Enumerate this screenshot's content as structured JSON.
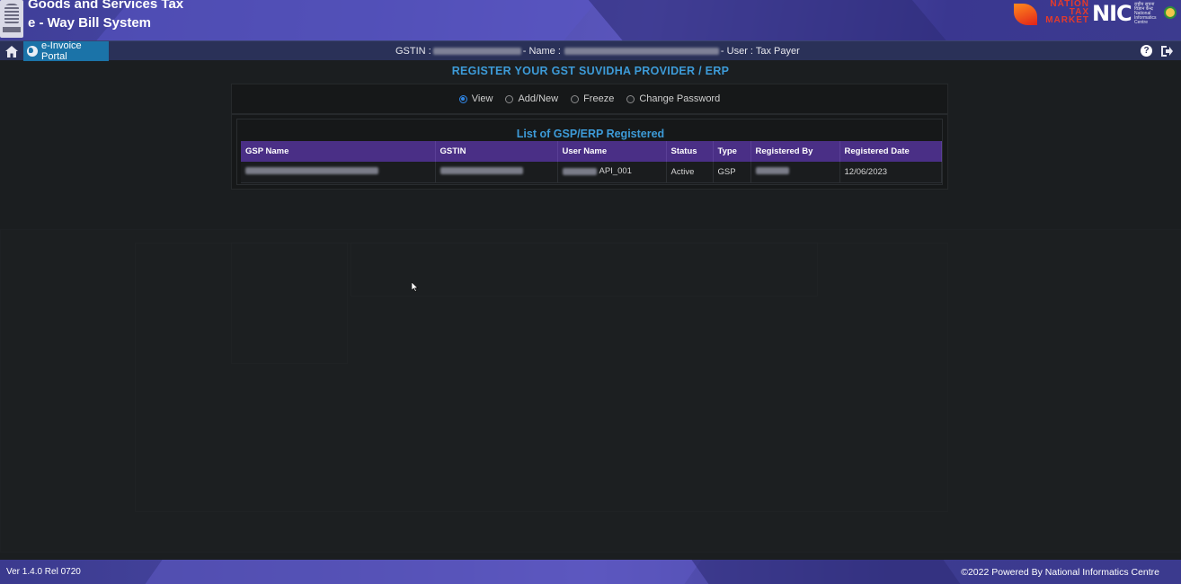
{
  "header": {
    "title_line1": "Goods and Services Tax",
    "title_line2": "e - Way Bill System",
    "ntm_logo_text": "NATION TAX MARKET",
    "nic_logo_text": "NIC",
    "nic_subtext": "राष्ट्रीय सूचना विज्ञान केन्द्र National Informatics Centre"
  },
  "navbar": {
    "home_icon": "home-icon",
    "portal_label": "e-Invoice Portal",
    "gstin_label": "GSTIN :",
    "name_label": "- Name :",
    "user_label": "- User : Tax Payer",
    "help_symbol": "?"
  },
  "main": {
    "page_title": "REGISTER YOUR GST SUVIDHA PROVIDER / ERP",
    "options": [
      {
        "label": "View",
        "checked": true
      },
      {
        "label": "Add/New",
        "checked": false
      },
      {
        "label": "Freeze",
        "checked": false
      },
      {
        "label": "Change Password",
        "checked": false
      }
    ],
    "list_title": "List of GSP/ERP Registered",
    "table": {
      "headers": [
        "GSP Name",
        "GSTIN",
        "User Name",
        "Status",
        "Type",
        "Registered By",
        "Registered Date"
      ],
      "rows": [
        {
          "gsp_name": "",
          "gstin": "",
          "user_name": "API_001",
          "status": "Active",
          "type": "GSP",
          "registered_by": "",
          "registered_date": "12/06/2023"
        }
      ]
    }
  },
  "footer": {
    "version": "Ver 1.4.0 Rel 0720",
    "powered_by": "©2022 Powered By National Informatics Centre"
  },
  "colors": {
    "accent_title": "#3d9bd8",
    "table_header": "#4a2f86",
    "portal_tab": "#1b73a8",
    "banner": "#4a49a6"
  }
}
